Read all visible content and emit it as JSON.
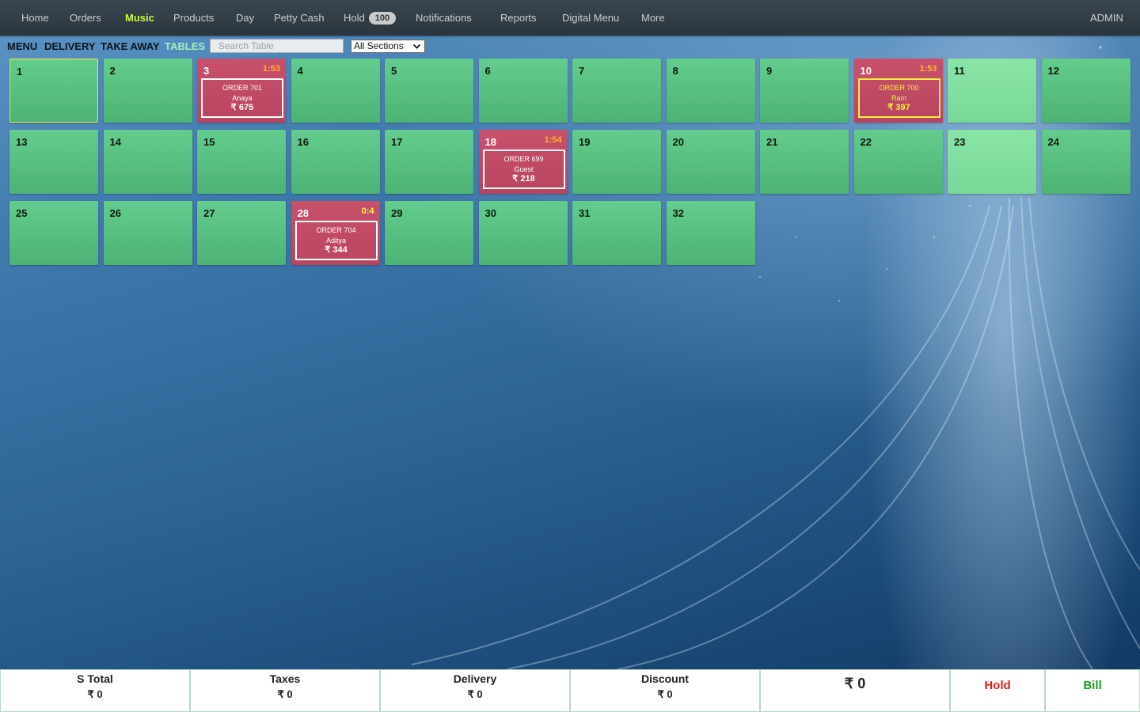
{
  "nav": {
    "items": [
      {
        "label": "Home"
      },
      {
        "label": "Orders"
      },
      {
        "label": "Music",
        "active": true
      },
      {
        "label": "Products"
      },
      {
        "label": "Day"
      },
      {
        "label": "Petty Cash"
      },
      {
        "label": "Hold",
        "badge": "100"
      },
      {
        "label": "Notifications"
      },
      {
        "label": "Reports"
      },
      {
        "label": "Digital Menu"
      },
      {
        "label": "More"
      }
    ],
    "user": "ADMIN"
  },
  "subnav": {
    "tabs": [
      {
        "label": "MENU"
      },
      {
        "label": "DELIVERY"
      },
      {
        "label": "TAKE AWAY"
      },
      {
        "label": "TABLES",
        "active": true
      }
    ],
    "search_placeholder": "Search Table",
    "section_selected": "All Sections"
  },
  "tables": [
    {
      "number": "1",
      "status": "free",
      "selected": true
    },
    {
      "number": "2",
      "status": "free"
    },
    {
      "number": "3",
      "status": "occupied",
      "time": "1:53",
      "order": "ORDER 701",
      "customer": "Anaya",
      "amount": "₹ 675"
    },
    {
      "number": "4",
      "status": "free"
    },
    {
      "number": "5",
      "status": "free"
    },
    {
      "number": "6",
      "status": "free"
    },
    {
      "number": "7",
      "status": "free"
    },
    {
      "number": "8",
      "status": "free"
    },
    {
      "number": "9",
      "status": "free"
    },
    {
      "number": "10",
      "status": "occupied",
      "highlight": true,
      "time": "1:53",
      "order": "ORDER 700",
      "customer": "Ram",
      "amount": "₹ 397"
    },
    {
      "number": "11",
      "status": "free"
    },
    {
      "number": "12",
      "status": "free"
    },
    {
      "number": "13",
      "status": "free"
    },
    {
      "number": "14",
      "status": "free"
    },
    {
      "number": "15",
      "status": "free"
    },
    {
      "number": "16",
      "status": "free"
    },
    {
      "number": "17",
      "status": "free"
    },
    {
      "number": "18",
      "status": "occupied",
      "time": "1:54",
      "order": "ORDER 699",
      "customer": "Guest",
      "amount": "₹ 218"
    },
    {
      "number": "19",
      "status": "free"
    },
    {
      "number": "20",
      "status": "free"
    },
    {
      "number": "21",
      "status": "free"
    },
    {
      "number": "22",
      "status": "free"
    },
    {
      "number": "23",
      "status": "free"
    },
    {
      "number": "24",
      "status": "free"
    },
    {
      "number": "25",
      "status": "free"
    },
    {
      "number": "26",
      "status": "free"
    },
    {
      "number": "27",
      "status": "free"
    },
    {
      "number": "28",
      "status": "occupied",
      "time": "0:4",
      "time_color": "yellow",
      "order": "ORDER 704",
      "customer": "Aditya",
      "amount": "₹ 344"
    },
    {
      "number": "29",
      "status": "free"
    },
    {
      "number": "30",
      "status": "free"
    },
    {
      "number": "31",
      "status": "free"
    },
    {
      "number": "32",
      "status": "free"
    }
  ],
  "totals": {
    "s_total_label": "S Total",
    "s_total_value": "₹ 0",
    "taxes_label": "Taxes",
    "taxes_value": "₹ 0",
    "delivery_label": "Delivery",
    "delivery_value": "₹ 0",
    "discount_label": "Discount",
    "discount_value": "₹ 0",
    "grand_total": "₹ 0",
    "hold_label": "Hold",
    "bill_label": "Bill"
  },
  "colors": {
    "free_table": "#5cc283",
    "occupied_table": "#c04a65",
    "active_nav": "#c8ff3c",
    "active_tab": "#9ff0c4",
    "hold": "#e01b1b",
    "bill": "#1f9b1f"
  }
}
